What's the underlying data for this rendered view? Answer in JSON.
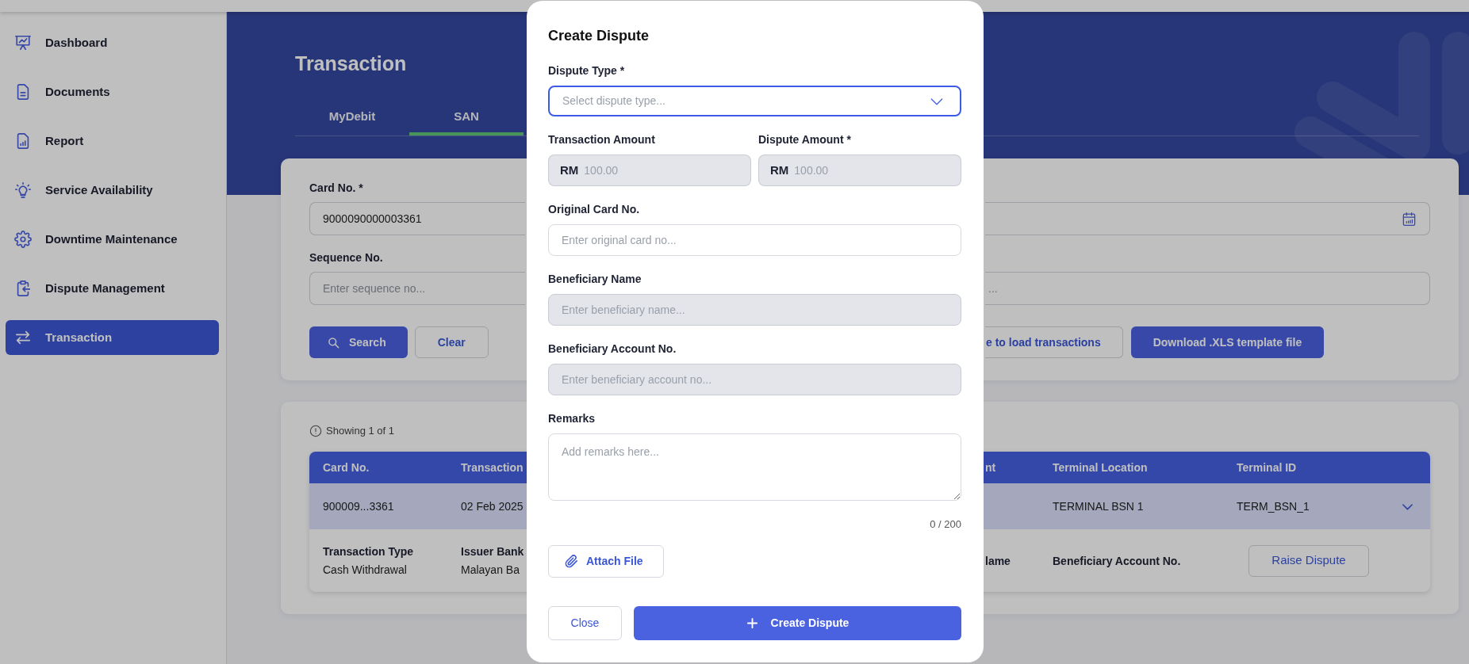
{
  "sidebar": {
    "items": [
      {
        "label": "Dashboard",
        "selected": false
      },
      {
        "label": "Documents",
        "selected": false
      },
      {
        "label": "Report",
        "selected": false
      },
      {
        "label": "Service Availability",
        "selected": false
      },
      {
        "label": "Downtime Maintenance",
        "selected": false
      },
      {
        "label": "Dispute Management",
        "selected": false
      },
      {
        "label": "Transaction",
        "selected": true
      }
    ]
  },
  "header": {
    "title": "Transaction",
    "tabs": [
      {
        "label": "MyDebit",
        "selected": false
      },
      {
        "label": "SAN",
        "selected": true
      }
    ]
  },
  "filter_card": {
    "rows": [
      {
        "left": {
          "label": "Card No. *",
          "value": "9000090000003361"
        },
        "right": {
          "kind": "date"
        }
      },
      {
        "left": {
          "label": "Sequence No.",
          "placeholder": "Enter sequence no..."
        },
        "right": {
          "kind": "text",
          "placeholder": "..."
        }
      }
    ],
    "buttons_left": [
      {
        "label": "Search",
        "kind": "search"
      },
      {
        "label": "Clear",
        "kind": "secondary"
      }
    ],
    "buttons_right": [
      {
        "label": "e to load transactions",
        "kind": "secondary"
      },
      {
        "label": "Download .XLS template file",
        "kind": "primary"
      }
    ]
  },
  "results_card": {
    "summary": "Showing 1 of 1",
    "table": {
      "columns": [
        "Card No.",
        "Transaction",
        "nt",
        "Terminal Location",
        "Terminal ID"
      ],
      "rows": [
        {
          "cells": [
            "900009...3361",
            "02 Feb 2025",
            null,
            "TERMINAL BSN 1",
            "TERM_BSN_1"
          ],
          "expanded": true,
          "details": [
            {
              "label": "Transaction Type",
              "value": "Cash Withdrawal"
            },
            {
              "label": "Issuer Bank",
              "value": "Malayan Ba"
            },
            {
              "label": "lame"
            },
            {
              "label": "Beneficiary Account No."
            }
          ],
          "action": "Raise Dispute"
        }
      ]
    }
  },
  "dialog": {
    "title": "Create Dispute",
    "rows": [
      [
        {
          "kind": "select",
          "label": "Dispute Type *",
          "placeholder": "Select dispute type...",
          "focused": true,
          "disabled": false
        }
      ],
      [
        {
          "kind": "amount",
          "label": "Transaction Amount",
          "prefix": "RM",
          "placeholder": "100.00",
          "focused": false,
          "disabled": true
        },
        {
          "kind": "amount",
          "label": "Dispute Amount *",
          "prefix": "RM",
          "placeholder": "100.00",
          "focused": false,
          "disabled": true
        }
      ],
      [
        {
          "kind": "text",
          "label": "Original Card No.",
          "placeholder": "Enter original card no...",
          "focused": false,
          "disabled": false
        }
      ],
      [
        {
          "kind": "text",
          "label": "Beneficiary Name",
          "placeholder": "Enter beneficiary name...",
          "focused": false,
          "disabled": true
        }
      ],
      [
        {
          "kind": "text",
          "label": "Beneficiary Account No.",
          "placeholder": "Enter beneficiary account no...",
          "focused": false,
          "disabled": true
        }
      ],
      [
        {
          "kind": "textarea",
          "label": "Remarks",
          "placeholder": "Add remarks here...",
          "counter": "0 / 200",
          "focused": false,
          "disabled": false
        }
      ]
    ],
    "attach_button": "Attach File",
    "buttons": [
      {
        "label": "Close",
        "kind": "secondary"
      },
      {
        "label": "Create Dispute",
        "kind": "primary"
      }
    ]
  }
}
